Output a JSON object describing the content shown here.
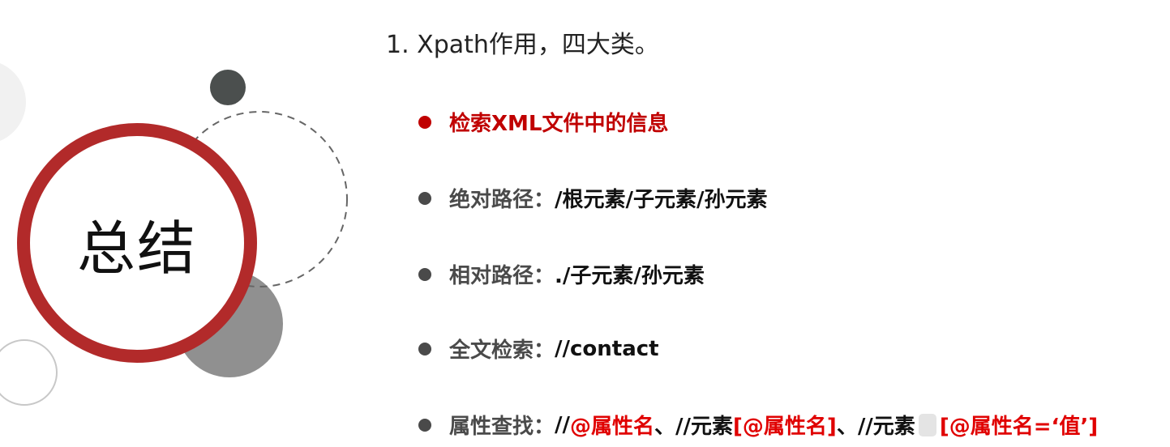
{
  "slide": {
    "badge_title": "总结",
    "heading": "1. Xpath作用，四大类。",
    "colors": {
      "accent_red": "#c00000",
      "ring_red": "#b22a2a",
      "highlight_red": "#e00000",
      "dark_gray": "#4a4a4a"
    },
    "bullets": [
      {
        "label": "检索XML文件中的信息"
      },
      {
        "label": "绝对路径：",
        "value": " /根元素/子元素/孙元素"
      },
      {
        "label": "相对路径：",
        "value": "./子元素/孙元素"
      },
      {
        "label": "全文检索：",
        "value": "//contact"
      },
      {
        "label": "属性查找：",
        "parts": [
          "//",
          "@属性名",
          " 、//元素",
          "[@属性名]",
          "、//元素",
          "[@属性名=‘值’]"
        ]
      }
    ]
  }
}
